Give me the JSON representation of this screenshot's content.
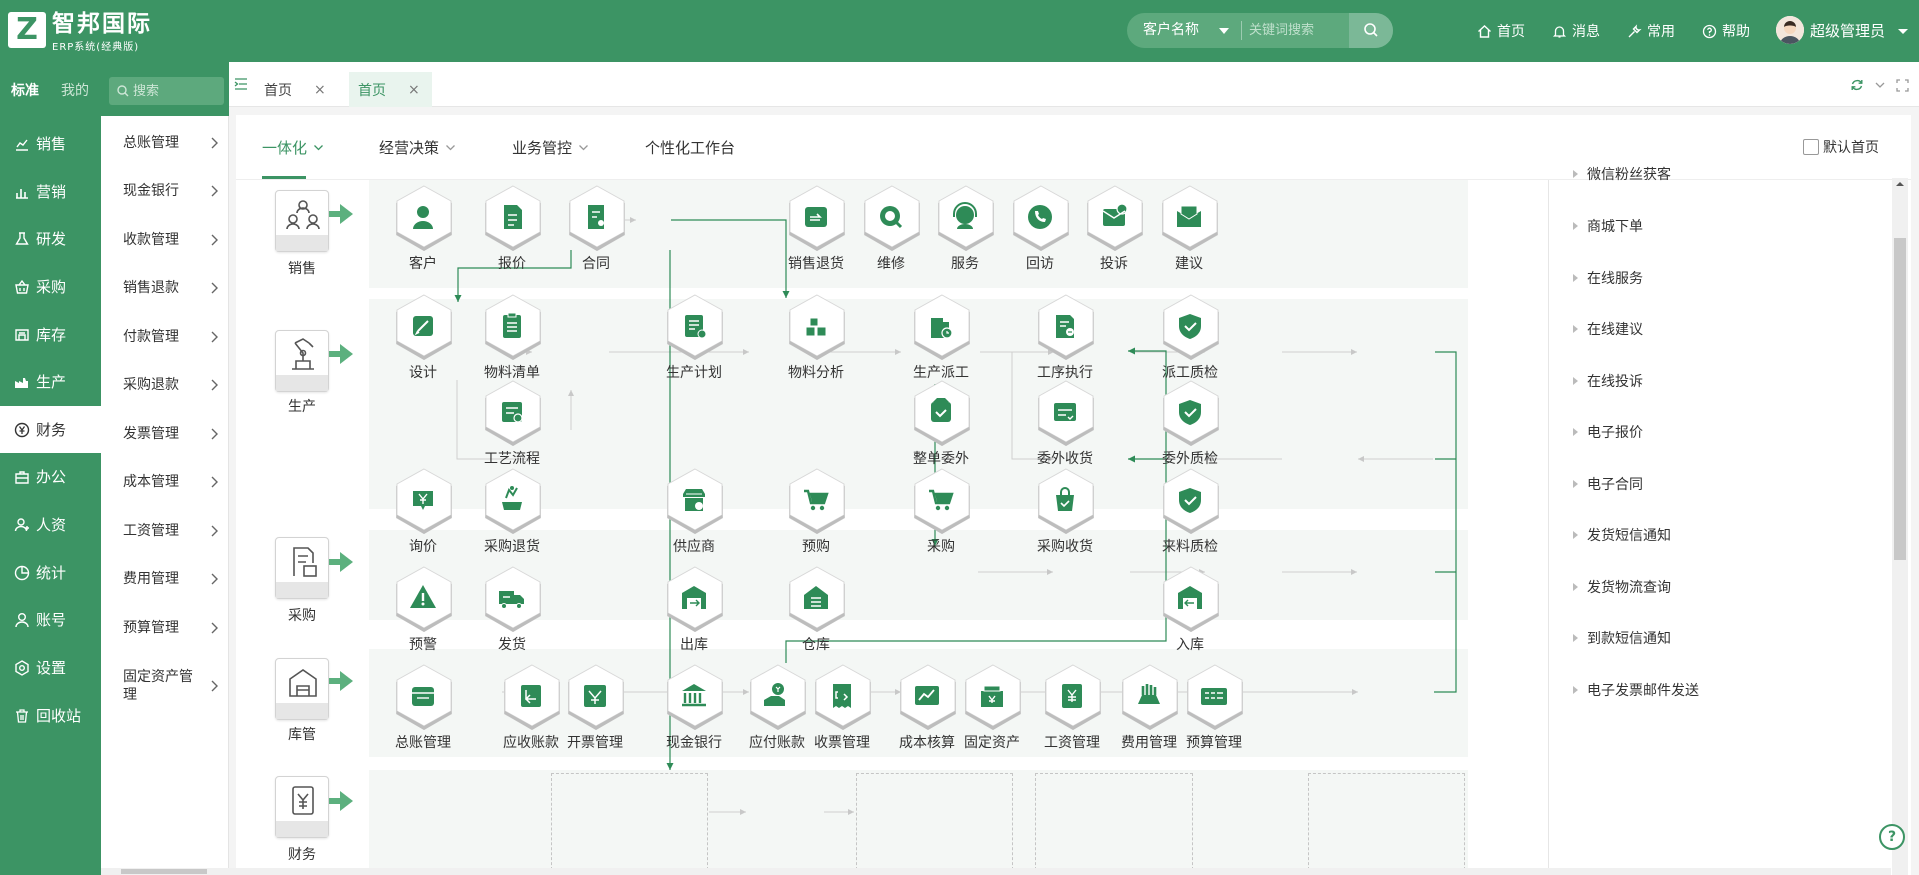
{
  "app": {
    "logo_letter": "Z",
    "title": "智邦国际",
    "subtitle": "ERP系统(经典版)"
  },
  "search": {
    "field_label": "客户名称",
    "placeholder": "关键词搜索"
  },
  "topnav": [
    {
      "label": "首页",
      "icon": "home-icon"
    },
    {
      "label": "消息",
      "icon": "bell-icon"
    },
    {
      "label": "常用",
      "icon": "wrench-icon"
    },
    {
      "label": "帮助",
      "icon": "help-circle-icon"
    }
  ],
  "user": {
    "name": "超级管理员"
  },
  "left": {
    "modes": [
      "标准",
      "我的"
    ],
    "items": [
      {
        "label": "销售",
        "icon": "chart-line-icon"
      },
      {
        "label": "营销",
        "icon": "bar-chart-icon"
      },
      {
        "label": "研发",
        "icon": "flask-icon"
      },
      {
        "label": "采购",
        "icon": "basket-icon"
      },
      {
        "label": "库存",
        "icon": "warehouse-icon"
      },
      {
        "label": "生产",
        "icon": "factory-icon"
      },
      {
        "label": "财务",
        "icon": "yen-circle-icon"
      },
      {
        "label": "办公",
        "icon": "briefcase-icon"
      },
      {
        "label": "人资",
        "icon": "people-icon"
      },
      {
        "label": "统计",
        "icon": "pie-chart-icon"
      },
      {
        "label": "账号",
        "icon": "user-icon"
      },
      {
        "label": "设置",
        "icon": "settings-icon"
      },
      {
        "label": "回收站",
        "icon": "trash-icon"
      }
    ],
    "active": "财务"
  },
  "sub": {
    "search_placeholder": "搜索",
    "items": [
      "总账管理",
      "现金银行",
      "收款管理",
      "销售退款",
      "付款管理",
      "采购退款",
      "发票管理",
      "成本管理",
      "工资管理",
      "费用管理",
      "预算管理",
      "固定资产管理"
    ]
  },
  "tabs": [
    {
      "label": "首页",
      "close": "×"
    },
    {
      "label": "首页",
      "close": "×"
    }
  ],
  "subnav": {
    "tabs": [
      "一体化",
      "经营决策",
      "业务管控",
      "个性化工作台"
    ],
    "active": "一体化",
    "default_home": "默认首页"
  },
  "categories": [
    "销售",
    "生产",
    "采购",
    "库管",
    "财务"
  ],
  "nodes": {
    "kehu": "客户",
    "baojia": "报价",
    "hetong": "合同",
    "xstuihuo": "销售退货",
    "weixiu": "维修",
    "fuwu": "服务",
    "huifang": "回访",
    "tousu": "投诉",
    "jianyi": "建议",
    "sheji": "设计",
    "wlqd": "物料清单",
    "scjh": "生产计划",
    "wlfx": "物料分析",
    "scpg": "生产派工",
    "gxzx": "工序执行",
    "pgzj": "派工质检",
    "gylc": "工艺流程",
    "zdww": "整单委外",
    "wwsh": "委外收货",
    "wwzj": "委外质检",
    "xunjia": "询价",
    "cgth": "采购退货",
    "gys": "供应商",
    "yugou": "预购",
    "caigou": "采购",
    "cgsh": "采购收货",
    "llzj": "来料质检",
    "yujing": "预警",
    "fahuo": "发货",
    "chuku": "出库",
    "cangku": "仓库",
    "ruku": "入库",
    "zzgl": "总账管理",
    "yszk": "应收账款",
    "kpgl": "开票管理",
    "xjyh": "现金银行",
    "yfzk": "应付账款",
    "spgl": "收票管理",
    "cbhs": "成本核算",
    "gdzc": "固定资产",
    "gzgl": "工资管理",
    "fygl": "费用管理",
    "ysgl": "预算管理"
  },
  "right_panel": [
    "微信粉丝获客",
    "商城下单",
    "在线服务",
    "在线建议",
    "在线投诉",
    "电子报价",
    "电子合同",
    "发货短信通知",
    "发货物流查询",
    "到款短信通知",
    "电子发票邮件发送"
  ],
  "colors": {
    "brand": "#3c9464",
    "lane_bg": "#f4f7f5",
    "icon_green": "#2e8b57"
  }
}
